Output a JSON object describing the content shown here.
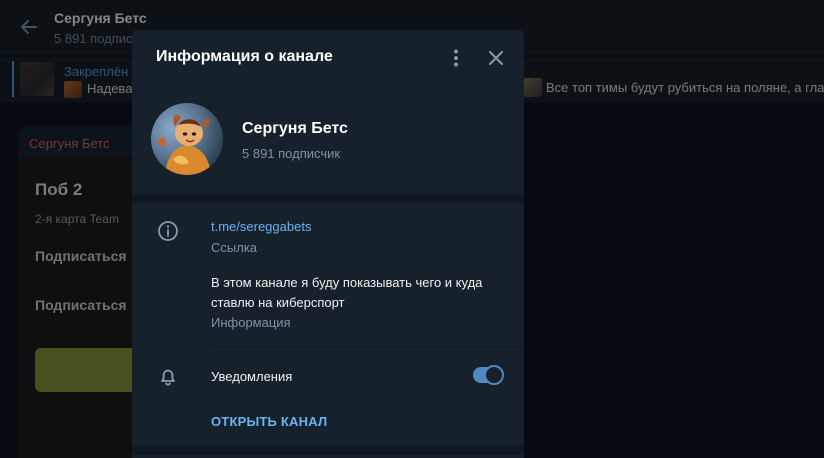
{
  "background": {
    "header": {
      "title": "Сергуня Бетс",
      "subtitle": "5 891 подписчик"
    },
    "pinned": {
      "label": "Закреплён",
      "text": "Надева",
      "text_right": "Все топ тимы будут рубиться на поляне, а гла"
    },
    "message": {
      "author": "Сергуня Бетс",
      "card_title": "Поб 2",
      "card_line": "2-я карта Team",
      "card_sub1": "Подписаться",
      "card_sub2": "Подписаться"
    }
  },
  "modal": {
    "title": "Информация о канале",
    "channel": {
      "name": "Сергуня Бетс",
      "subscribers": "5 891 подписчик"
    },
    "link": {
      "value": "t.me/sereggabets",
      "label": "Ссылка"
    },
    "description": {
      "text": "В этом канале я буду показывать чего и куда ставлю на киберспорт",
      "label": "Информация"
    },
    "notifications": {
      "label": "Уведомления",
      "enabled": true
    },
    "open_button": "ОТКРЫТЬ КАНАЛ"
  },
  "colors": {
    "accent": "#6ab3f3",
    "toggle": "#5288c1",
    "author": "#e06767",
    "card_button": "#889a3c"
  },
  "icons": {
    "back": "arrow-left-icon",
    "more": "more-vertical-icon",
    "close": "close-icon",
    "info": "info-icon",
    "notifications": "bell-icon"
  }
}
